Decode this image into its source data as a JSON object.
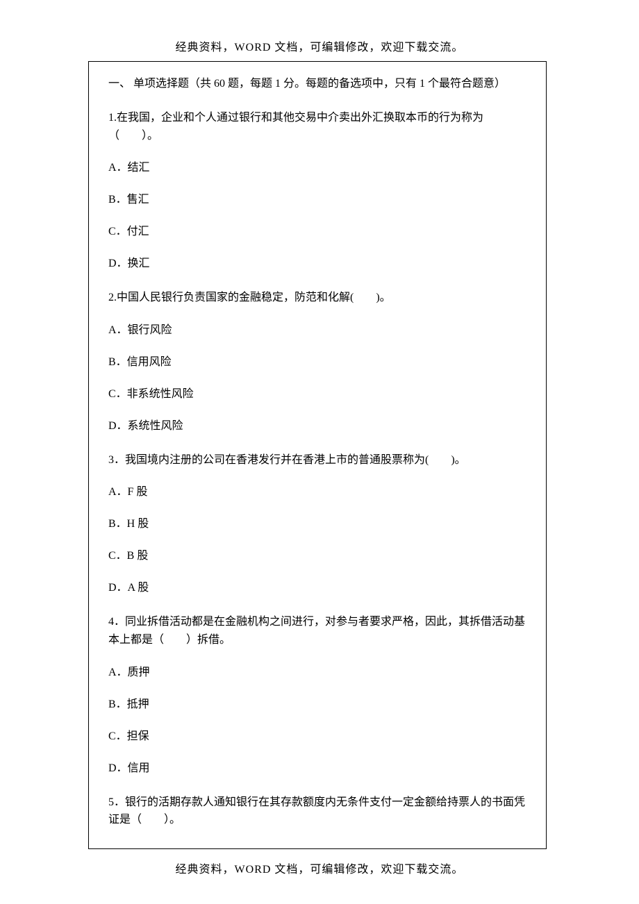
{
  "header": "经典资料，WORD 文档，可编辑修改，欢迎下载交流。",
  "footer": "经典资料，WORD 文档，可编辑修改，欢迎下载交流。",
  "sectionTitle": "一、 单项选择题（共 60 题，每题 1 分。每题的备选项中，只有 1 个最符合题意）",
  "questions": [
    {
      "number": "1.",
      "text": "在我国，企业和个人通过银行和其他交易中介卖出外汇换取本币的行为称为（　　）。",
      "options": [
        "A．结汇",
        "B．售汇",
        "C．付汇",
        "D．换汇"
      ]
    },
    {
      "number": "2.",
      "text": "中国人民银行负责国家的金融稳定，防范和化解(　　)。",
      "options": [
        "A．银行风险",
        "B．信用风险",
        "C．非系统性风险",
        "D．系统性风险"
      ]
    },
    {
      "number": "3．",
      "text": "我国境内注册的公司在香港发行并在香港上市的普通股票称为(　　)。",
      "options": [
        "A．F 股",
        "B．H 股",
        "C．B 股",
        "D．A 股"
      ]
    },
    {
      "number": "4．",
      "text": "同业拆借活动都是在金融机构之间进行，对参与者要求严格，因此，其拆借活动基本上都是（　　）拆借。",
      "options": [
        "A．质押",
        "B．抵押",
        "C．担保",
        "D．信用"
      ]
    },
    {
      "number": "5．",
      "text": "银行的活期存款人通知银行在其存款额度内无条件支付一定金额给持票人的书面凭证是（　　）。",
      "options": []
    }
  ]
}
